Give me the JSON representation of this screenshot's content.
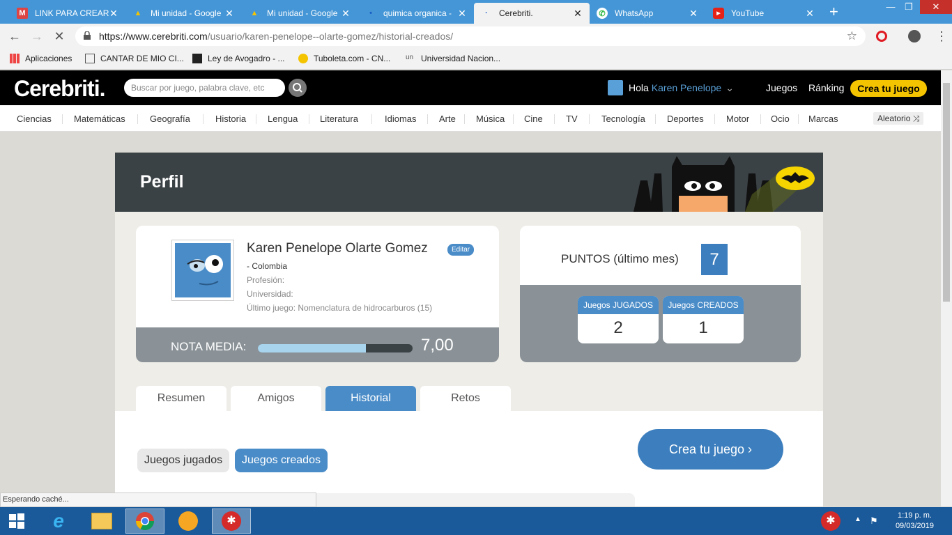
{
  "browser": {
    "tabs": [
      {
        "title": "LINK PARA CREAR",
        "icon": "gmail-icon"
      },
      {
        "title": "Mi unidad - Google",
        "icon": "drive-icon"
      },
      {
        "title": "Mi unidad - Google",
        "icon": "drive-icon"
      },
      {
        "title": "quimica organica -",
        "icon": "docs-icon"
      },
      {
        "title": "Cerebriti.",
        "icon": "loading-icon",
        "active": true
      },
      {
        "title": "WhatsApp",
        "icon": "whatsapp-icon"
      },
      {
        "title": "YouTube",
        "icon": "youtube-icon"
      }
    ],
    "url_prefix": "https://www.cerebriti.com",
    "url_path": "/usuario/karen-penelope--olarte-gomez/historial-creados/",
    "bookmarks": [
      "Aplicaciones",
      "CANTAR DE MIO CI...",
      "Ley de Avogadro - ...",
      "Tuboleta.com - CN...",
      "Universidad Nacion..."
    ],
    "status": "Esperando caché..."
  },
  "site": {
    "logo": "Cerebriti.",
    "search_placeholder": "Buscar por juego, palabra clave, etc",
    "greeting": "Hola",
    "user": "Karen Penelope",
    "nav_juegos": "Juegos",
    "nav_ranking": "Ránking",
    "crea_top": "Crea tu juego",
    "categories": [
      "Ciencias",
      "Matemáticas",
      "Geografía",
      "Historia",
      "Lengua",
      "Literatura",
      "Idiomas",
      "Arte",
      "Música",
      "Cine",
      "TV",
      "Tecnología",
      "Deportes",
      "Motor",
      "Ocio",
      "Marcas"
    ],
    "aleatorio": "Aleatorio ⤨"
  },
  "profile": {
    "banner_title": "Perfil",
    "name": "Karen Penelope Olarte Gomez",
    "edit": "Editar",
    "country": "- Colombia",
    "profesion": "Profesión:",
    "universidad": "Universidad:",
    "ultimo_juego": "Último juego: Nomenclatura de hidrocarburos (15)",
    "nota_label": "NOTA MEDIA:",
    "nota_value": "7,00",
    "nota_fraction": 0.7,
    "puntos_label": "PUNTOS (último mes)",
    "puntos_value": "7",
    "jugados_label": "Juegos JUGADOS",
    "jugados_value": "2",
    "creados_label": "Juegos CREADOS",
    "creados_value": "1",
    "tabs": [
      "Resumen",
      "Amigos",
      "Historial",
      "Retos"
    ],
    "subtabs": [
      "Juegos jugados",
      "Juegos creados"
    ],
    "crea_big": "Crea tu juego ›"
  },
  "taskbar": {
    "time": "1:19 p. m.",
    "date": "09/03/2019"
  }
}
